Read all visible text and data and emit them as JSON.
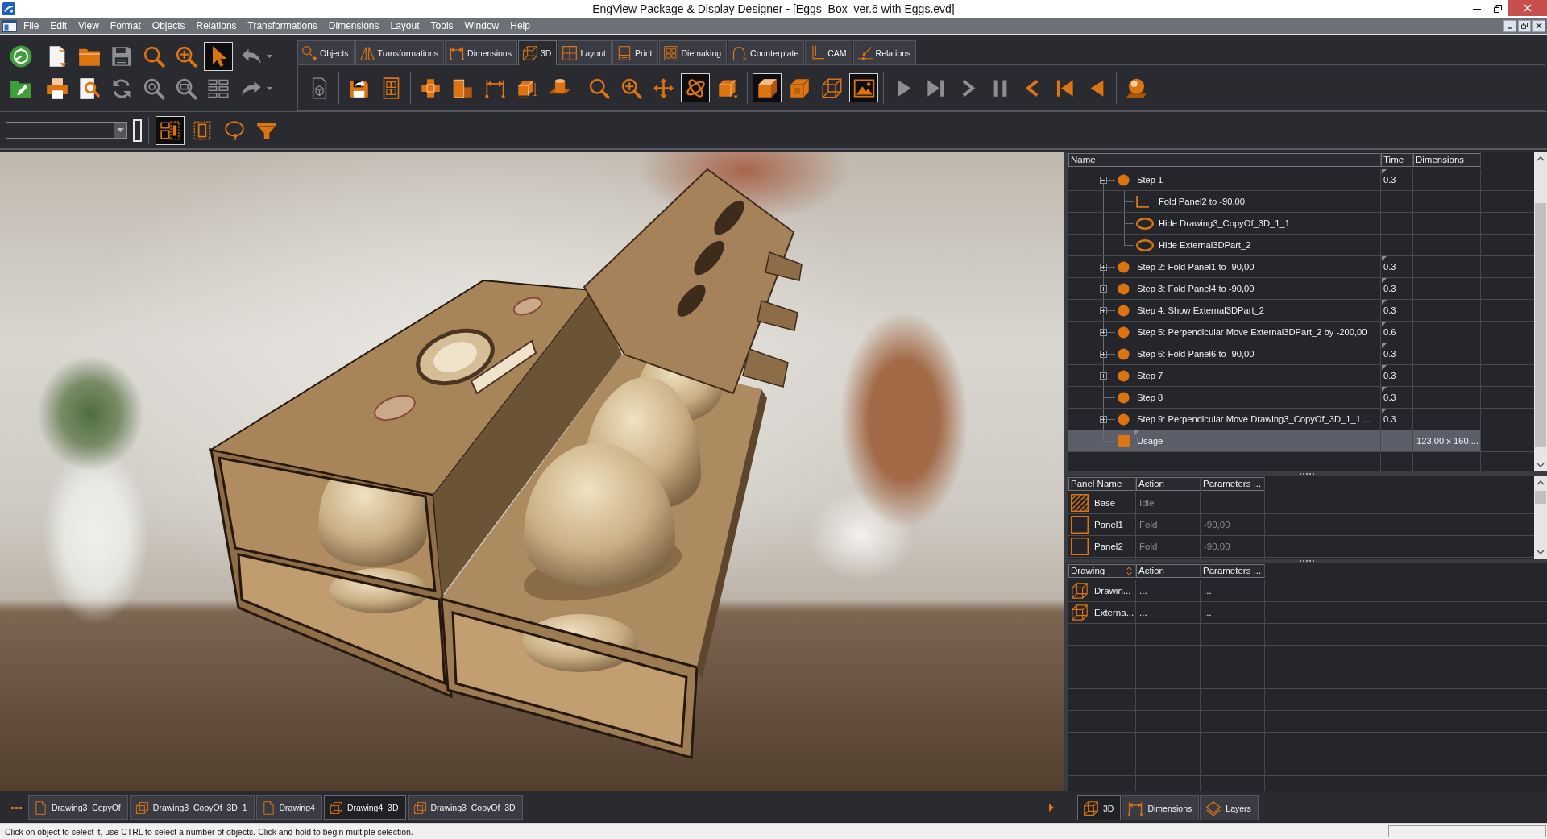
{
  "window": {
    "title": "EngView Package & Display Designer - [Eggs_Box_ver.6 with Eggs.evd]"
  },
  "menu_bar": [
    "File",
    "Edit",
    "View",
    "Format",
    "Objects",
    "Relations",
    "Transformations",
    "Dimensions",
    "Layout",
    "Tools",
    "Window",
    "Help"
  ],
  "quick_toolbar": {
    "rows": [
      [
        {
          "kind": "gauge",
          "selected": false,
          "disabled": false
        },
        {
          "kind": "newdoc",
          "selected": false,
          "disabled": false
        },
        {
          "kind": "open",
          "selected": false,
          "disabled": false
        },
        {
          "kind": "save",
          "selected": false,
          "disabled": true
        },
        {
          "kind": "zoom",
          "selected": false,
          "disabled": false
        },
        {
          "kind": "zoomin",
          "selected": false,
          "disabled": false
        },
        {
          "kind": "pointer",
          "selected": true,
          "disabled": false
        },
        {
          "kind": "undo",
          "selected": false,
          "disabled": true
        }
      ],
      [
        {
          "kind": "pencilfolder",
          "selected": false,
          "disabled": false
        },
        {
          "kind": "print",
          "selected": false,
          "disabled": false
        },
        {
          "kind": "preview",
          "selected": false,
          "disabled": false
        },
        {
          "kind": "refresh",
          "selected": false,
          "disabled": true
        },
        {
          "kind": "zoomfit",
          "selected": false,
          "disabled": true
        },
        {
          "kind": "zoomwindow",
          "selected": false,
          "disabled": true
        },
        {
          "kind": "list",
          "selected": false,
          "disabled": true
        },
        {
          "kind": "redo",
          "selected": false,
          "disabled": true
        }
      ]
    ]
  },
  "ribbon": {
    "tabs": [
      {
        "label": "Objects",
        "kind": "nodes",
        "selected": false
      },
      {
        "label": "Transformations",
        "kind": "mirror",
        "selected": false
      },
      {
        "label": "Dimensions",
        "kind": "dimension",
        "selected": false
      },
      {
        "label": "3D",
        "kind": "cube",
        "selected": true
      },
      {
        "label": "Layout",
        "kind": "grid",
        "selected": false
      },
      {
        "label": "Print",
        "kind": "print",
        "selected": false
      },
      {
        "label": "Diemaking",
        "kind": "diemaking",
        "selected": false
      },
      {
        "label": "Counterplate",
        "kind": "arch",
        "selected": false
      },
      {
        "label": "CAM",
        "kind": "cam",
        "selected": false
      },
      {
        "label": "Relations",
        "kind": "relation",
        "selected": false
      }
    ],
    "tool_groups": [
      [
        {
          "kind": "cubedoc",
          "selected": false,
          "disabled": true
        }
      ],
      [
        {
          "kind": "export",
          "selected": false,
          "disabled": false
        },
        {
          "kind": "layoutdoc",
          "selected": false,
          "disabled": false
        }
      ],
      [
        {
          "kind": "unfold",
          "selected": false,
          "disabled": false
        },
        {
          "kind": "panels",
          "selected": false,
          "disabled": false
        },
        {
          "kind": "dimension",
          "selected": false,
          "disabled": false
        },
        {
          "kind": "cubedim",
          "selected": false,
          "disabled": false
        },
        {
          "kind": "cylinder",
          "selected": false,
          "disabled": false
        }
      ],
      [
        {
          "kind": "zoom",
          "selected": false,
          "disabled": false
        },
        {
          "kind": "zoomin",
          "selected": false,
          "disabled": false
        },
        {
          "kind": "move",
          "selected": false,
          "disabled": false
        },
        {
          "kind": "rotate",
          "selected": true,
          "disabled": false
        },
        {
          "kind": "box",
          "selected": false,
          "disabled": false
        }
      ],
      [
        {
          "kind": "solidcube",
          "selected": true,
          "disabled": false
        },
        {
          "kind": "shadedcube",
          "selected": false,
          "disabled": false
        },
        {
          "kind": "wirecube",
          "selected": false,
          "disabled": false
        },
        {
          "kind": "image",
          "selected": true,
          "disabled": false
        }
      ],
      [
        {
          "kind": "play",
          "selected": false,
          "disabled": true
        },
        {
          "kind": "skipfwd",
          "selected": false,
          "disabled": true
        },
        {
          "kind": "next",
          "selected": false,
          "disabled": true
        },
        {
          "kind": "pause",
          "selected": false,
          "disabled": true
        },
        {
          "kind": "prev",
          "selected": false,
          "disabled": false
        },
        {
          "kind": "skipback",
          "selected": false,
          "disabled": false
        },
        {
          "kind": "reverse",
          "selected": false,
          "disabled": false
        }
      ],
      [
        {
          "kind": "sphere",
          "selected": false,
          "disabled": false
        }
      ]
    ]
  },
  "selection_toolbar": {
    "tools": [
      {
        "kind": "selectgroup",
        "selected": true,
        "disabled": false
      },
      {
        "kind": "selectframe",
        "selected": false,
        "disabled": false
      },
      {
        "kind": "lasso",
        "selected": false,
        "disabled": false
      },
      {
        "kind": "filter",
        "selected": false,
        "disabled": false
      }
    ]
  },
  "steps_tree": {
    "columns": [
      "Name",
      "Time",
      "Dimensions"
    ],
    "rows": [
      {
        "name": "Step 1",
        "kind": "step",
        "time": "0.3",
        "expanded": true,
        "selected": false,
        "children": [
          {
            "name": "Fold Panel2 to -90,00",
            "kind": "fold",
            "selected": false
          },
          {
            "name": "Hide Drawing3_CopyOf_3D_1_1",
            "kind": "hide",
            "selected": false
          },
          {
            "name": "Hide External3DPart_2",
            "kind": "hide",
            "selected": false
          }
        ]
      },
      {
        "name": "Step 2: Fold Panel1 to -90,00",
        "kind": "step",
        "time": "0.3",
        "expanded": false,
        "selected": false
      },
      {
        "name": "Step 3: Fold Panel4 to -90,00",
        "kind": "step",
        "time": "0.3",
        "expanded": false,
        "selected": false
      },
      {
        "name": "Step 4: Show External3DPart_2",
        "kind": "step",
        "time": "0.3",
        "expanded": false,
        "selected": false
      },
      {
        "name": "Step 5: Perpendicular Move External3DPart_2 by -200,00",
        "kind": "step",
        "time": "0.6",
        "expanded": false,
        "selected": false
      },
      {
        "name": "Step 6: Fold Panel6 to -90,00",
        "kind": "step",
        "time": "0.3",
        "expanded": false,
        "selected": false
      },
      {
        "name": "Step 7",
        "kind": "step",
        "time": "0.3",
        "expanded": false,
        "selected": false
      },
      {
        "name": "Step 8",
        "kind": "step",
        "time": "0.3",
        "selected": false
      },
      {
        "name": "Step 9: Perpendicular Move Drawing3_CopyOf_3D_1_1 ...",
        "kind": "step",
        "time": "0.3",
        "expanded": false,
        "selected": false
      },
      {
        "name": "Usage",
        "kind": "usage",
        "dimensions": "123,00 x 160,...",
        "selected": true
      }
    ]
  },
  "panels_table": {
    "columns": [
      "Panel Name",
      "Action",
      "Parameters ..."
    ],
    "rows": [
      {
        "name": "Base",
        "kind": "base",
        "action": "Idle"
      },
      {
        "name": "Panel1",
        "kind": "panel",
        "action": "Fold",
        "parameters": "-90,00"
      },
      {
        "name": "Panel2",
        "kind": "panel",
        "action": "Fold",
        "parameters": "-90,00"
      }
    ]
  },
  "drawings_table": {
    "columns": [
      "Drawing",
      "Action",
      "Parameters ..."
    ],
    "rows": [
      {
        "name": "Drawin...",
        "action": "...",
        "parameters": "..."
      },
      {
        "name": "Externa...",
        "action": "...",
        "parameters": "..."
      }
    ]
  },
  "document_tabs": [
    {
      "label": "Drawing3_CopyOf",
      "kind": "sheet",
      "selected": false
    },
    {
      "label": "Drawing3_CopyOf_3D_1",
      "kind": "cube",
      "selected": false
    },
    {
      "label": "Drawing4",
      "kind": "sheet",
      "selected": false
    },
    {
      "label": "Drawing4_3D",
      "kind": "cube",
      "selected": true
    },
    {
      "label": "Drawing3_CopyOf_3D",
      "kind": "cube",
      "selected": false
    }
  ],
  "panel_tabs": [
    {
      "label": "3D",
      "kind": "cube",
      "selected": true
    },
    {
      "label": "Dimensions",
      "kind": "dimension",
      "selected": false
    },
    {
      "label": "Layers",
      "kind": "layers",
      "selected": false
    }
  ],
  "status_bar": {
    "text": "Click on object to select it, use CTRL to select a number of objects. Click and hold to begin multiple selection."
  }
}
